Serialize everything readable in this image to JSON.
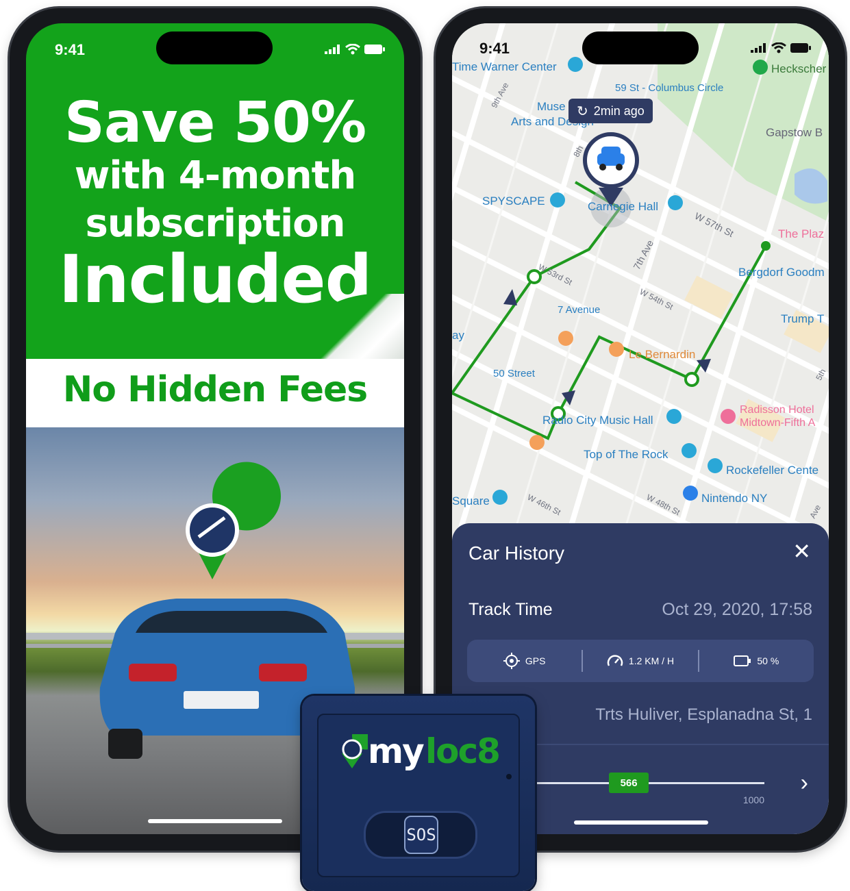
{
  "left_phone": {
    "status_time": "9:41",
    "promo": {
      "line1": "Save 50%",
      "line2": "with 4-month",
      "line3": "subscription",
      "line4": "Included"
    },
    "banner": "No Hidden Fees",
    "brand_green": "#13a31b"
  },
  "right_phone": {
    "status_time": "9:41",
    "map": {
      "refresh_badge": "2min ago",
      "places": [
        "Time Warner Center",
        "59 St - Columbus Circle",
        "Heckscher",
        "Muse",
        "Arts and Design",
        "Gapstow B",
        "SPYSCAPE",
        "Carnegie Hall",
        "The Plaz",
        "Bergdorf Goodm",
        "7 Avenue",
        "Trump T",
        "Le Bernardin",
        "50 Street",
        "Radio City Music Hall",
        "Radisson Hotel",
        "Midtown-Fifth A",
        "Top of The Rock",
        "Rockefeller Cente",
        "Nintendo NY",
        "Square",
        "ay"
      ],
      "streets": [
        "9th Ave",
        "W 57th St",
        "8th",
        "7th Ave",
        "W 53rd St",
        "W 54th St",
        "W 46th St",
        "W 48th St",
        "5th",
        "Ave"
      ],
      "route_color": "#1f9a1f"
    },
    "car_history": {
      "title": "Car History",
      "track_time_label": "Track Time",
      "track_time_value": "Oct 29, 2020, 17:58",
      "stats": {
        "gps": "GPS",
        "speed": "1.2 KM / H",
        "battery": "50 %"
      },
      "address": "Trts Huliver, Esplanadna St, 1",
      "slider": {
        "value_label": "566",
        "max_label": "1000",
        "value": 566,
        "max": 1000
      },
      "card_color": "#2f3b63"
    }
  },
  "device": {
    "brand_my": "my",
    "brand_loc": "loc8",
    "sos_label": "SOS"
  }
}
